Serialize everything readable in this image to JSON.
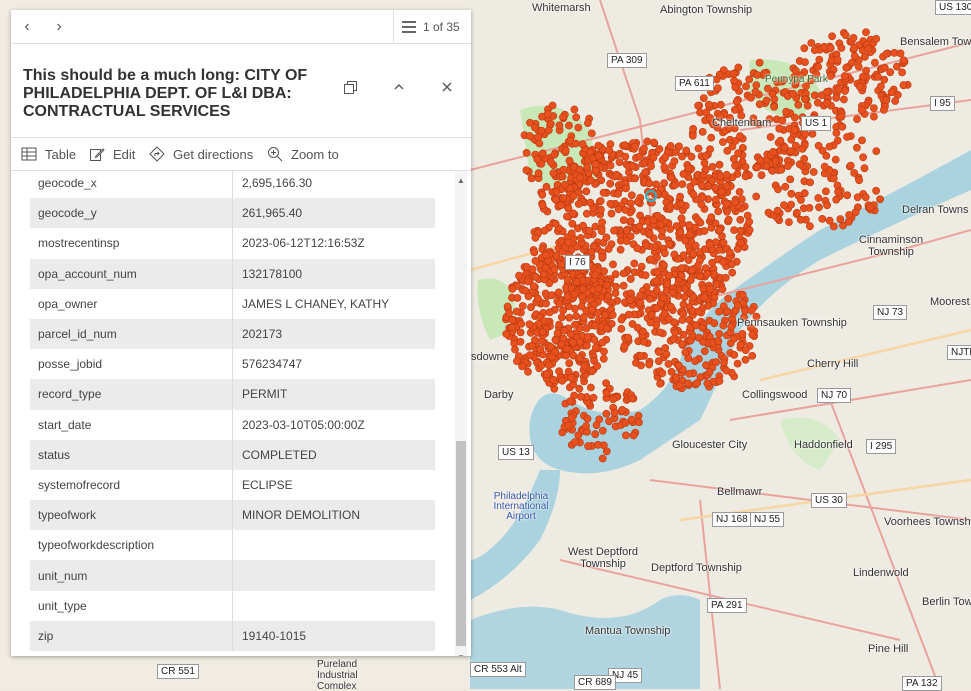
{
  "popup": {
    "pager_text": "1 of 35",
    "title": "This should be a much long: CITY OF PHILADELPHIA DEPT. OF L&I DBA: CONTRACTUAL SERVICES",
    "actions": {
      "table": "Table",
      "edit": "Edit",
      "directions": "Get directions",
      "zoom": "Zoom to"
    },
    "fields": [
      {
        "key": "geocode_x",
        "value": "2,695,166.30"
      },
      {
        "key": "geocode_y",
        "value": "261,965.40"
      },
      {
        "key": "mostrecentinsp",
        "value": "2023-06-12T12:16:53Z"
      },
      {
        "key": "opa_account_num",
        "value": "132178100"
      },
      {
        "key": "opa_owner",
        "value": "JAMES L CHANEY, KATHY"
      },
      {
        "key": "parcel_id_num",
        "value": "202173"
      },
      {
        "key": "posse_jobid",
        "value": "576234747"
      },
      {
        "key": "record_type",
        "value": "PERMIT"
      },
      {
        "key": "start_date",
        "value": "2023-03-10T05:00:00Z"
      },
      {
        "key": "status",
        "value": "COMPLETED"
      },
      {
        "key": "systemofrecord",
        "value": "ECLIPSE"
      },
      {
        "key": "typeofwork",
        "value": "MINOR DEMOLITION"
      },
      {
        "key": "typeofworkdescription",
        "value": ""
      },
      {
        "key": "unit_num",
        "value": ""
      },
      {
        "key": "unit_type",
        "value": ""
      },
      {
        "key": "zip",
        "value": "19140-1015"
      }
    ]
  },
  "map": {
    "places": [
      "Whitemarsh",
      "Abington Township",
      "Bensalem Tow",
      "Pennypa Park",
      "Cheltenham",
      "Delran Towns",
      "Cinnaminson Township",
      "Moorest",
      "Pennsauken Township",
      "Cherry Hill",
      "Collingswood",
      "Haddonfield",
      "Gloucester City",
      "Bellmawr",
      "Voorhees Townshi",
      "West Deptford Township",
      "Deptford Township",
      "Lindenwold",
      "Berlin Tow",
      "Pine Hill",
      "Mantua Township",
      "Darby",
      "sdowne",
      "Philadelphia International Airport",
      "Pureland Industrial Complex"
    ],
    "roads": [
      "PA 309",
      "PA 611",
      "US 1",
      "I 95",
      "I 76",
      "NJ 73",
      "NJTP",
      "NJ 70",
      "I 295",
      "US 30",
      "NJ 168",
      "NJ 55",
      "PA 291",
      "US 13",
      "CR 551",
      "CR 553 Alt",
      "NJ 45",
      "CR 689",
      "PA 132",
      "US 130"
    ],
    "colors": {
      "point": "#e8501e",
      "water": "#aad3df",
      "park": "#c8facc",
      "land": "#f2efe9",
      "selected": "#2ab5c8"
    }
  }
}
